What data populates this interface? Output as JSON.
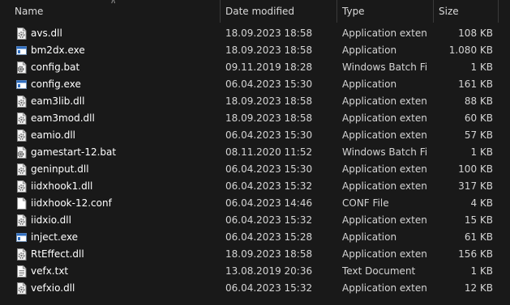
{
  "columns": {
    "name": "Name",
    "date": "Date modified",
    "type": "Type",
    "size": "Size"
  },
  "files": [
    {
      "name": "avs.dll",
      "date": "18.09.2023 18:58",
      "type": "Application exten...",
      "size": "108 KB",
      "icon": "dll-gear-icon"
    },
    {
      "name": "bm2dx.exe",
      "date": "18.09.2023 18:58",
      "type": "Application",
      "size": "1.080 KB",
      "icon": "exe-window-icon"
    },
    {
      "name": "config.bat",
      "date": "09.11.2019 18:28",
      "type": "Windows Batch File",
      "size": "1 KB",
      "icon": "batch-gear-icon"
    },
    {
      "name": "config.exe",
      "date": "06.04.2023 15:30",
      "type": "Application",
      "size": "161 KB",
      "icon": "exe-window-icon"
    },
    {
      "name": "eam3lib.dll",
      "date": "18.09.2023 18:58",
      "type": "Application exten...",
      "size": "88 KB",
      "icon": "dll-gear-icon"
    },
    {
      "name": "eam3mod.dll",
      "date": "18.09.2023 18:58",
      "type": "Application exten...",
      "size": "60 KB",
      "icon": "dll-gear-icon"
    },
    {
      "name": "eamio.dll",
      "date": "06.04.2023 15:30",
      "type": "Application exten...",
      "size": "57 KB",
      "icon": "dll-gear-icon"
    },
    {
      "name": "gamestart-12.bat",
      "date": "08.11.2020 11:52",
      "type": "Windows Batch File",
      "size": "1 KB",
      "icon": "batch-gear-icon"
    },
    {
      "name": "geninput.dll",
      "date": "06.04.2023 15:30",
      "type": "Application exten...",
      "size": "100 KB",
      "icon": "dll-gear-icon"
    },
    {
      "name": "iidxhook1.dll",
      "date": "06.04.2023 15:32",
      "type": "Application exten...",
      "size": "317 KB",
      "icon": "dll-gear-icon"
    },
    {
      "name": "iidxhook-12.conf",
      "date": "06.04.2023 14:46",
      "type": "CONF File",
      "size": "4 KB",
      "icon": "blank-file-icon"
    },
    {
      "name": "iidxio.dll",
      "date": "06.04.2023 15:32",
      "type": "Application exten...",
      "size": "15 KB",
      "icon": "dll-gear-icon"
    },
    {
      "name": "inject.exe",
      "date": "06.04.2023 15:28",
      "type": "Application",
      "size": "61 KB",
      "icon": "exe-window-icon"
    },
    {
      "name": "RtEffect.dll",
      "date": "18.09.2023 18:58",
      "type": "Application exten...",
      "size": "156 KB",
      "icon": "dll-gear-icon"
    },
    {
      "name": "vefx.txt",
      "date": "13.08.2019 20:36",
      "type": "Text Document",
      "size": "1 KB",
      "icon": "text-file-icon"
    },
    {
      "name": "vefxio.dll",
      "date": "06.04.2023 15:32",
      "type": "Application exten...",
      "size": "12 KB",
      "icon": "dll-gear-icon"
    }
  ]
}
